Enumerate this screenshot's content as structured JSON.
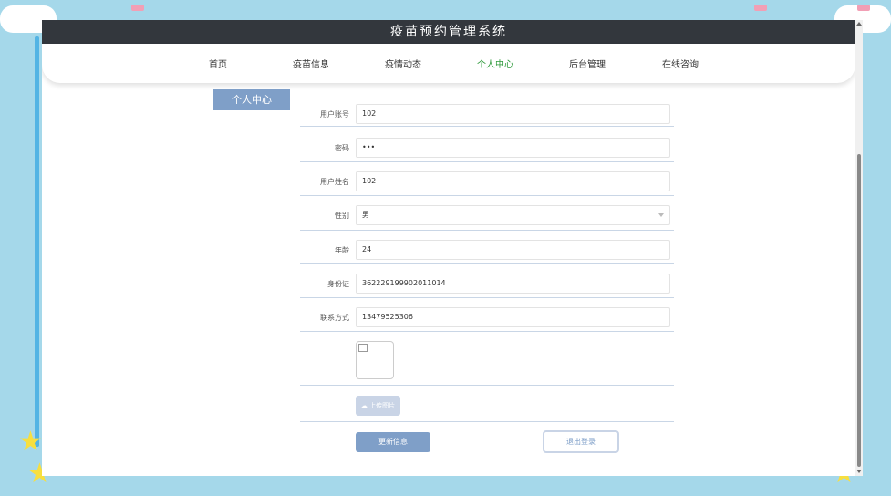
{
  "app": {
    "title": "疫苗预约管理系统"
  },
  "nav": {
    "items": [
      {
        "label": "首页"
      },
      {
        "label": "疫苗信息"
      },
      {
        "label": "疫情动态"
      },
      {
        "label": "个人中心",
        "active": true
      },
      {
        "label": "后台管理"
      },
      {
        "label": "在线咨询"
      }
    ]
  },
  "sidebar": {
    "tab_label": "个人中心"
  },
  "form": {
    "account": {
      "label": "用户账号",
      "value": "102"
    },
    "password": {
      "label": "密码",
      "value": "•••"
    },
    "name": {
      "label": "用户姓名",
      "value": "102"
    },
    "gender": {
      "label": "性别",
      "value": "男"
    },
    "age": {
      "label": "年龄",
      "value": "24"
    },
    "id_card": {
      "label": "身份证",
      "value": "362229199902011014"
    },
    "phone": {
      "label": "联系方式",
      "value": "13479525306"
    },
    "upload_label": "上传图片",
    "update_label": "更新信息",
    "logout_label": "退出登录"
  },
  "colors": {
    "accent": "#7f9fc8",
    "active_nav": "#2e9a3b",
    "title_bar": "#33373d",
    "page_bg": "#a5d8ea"
  }
}
